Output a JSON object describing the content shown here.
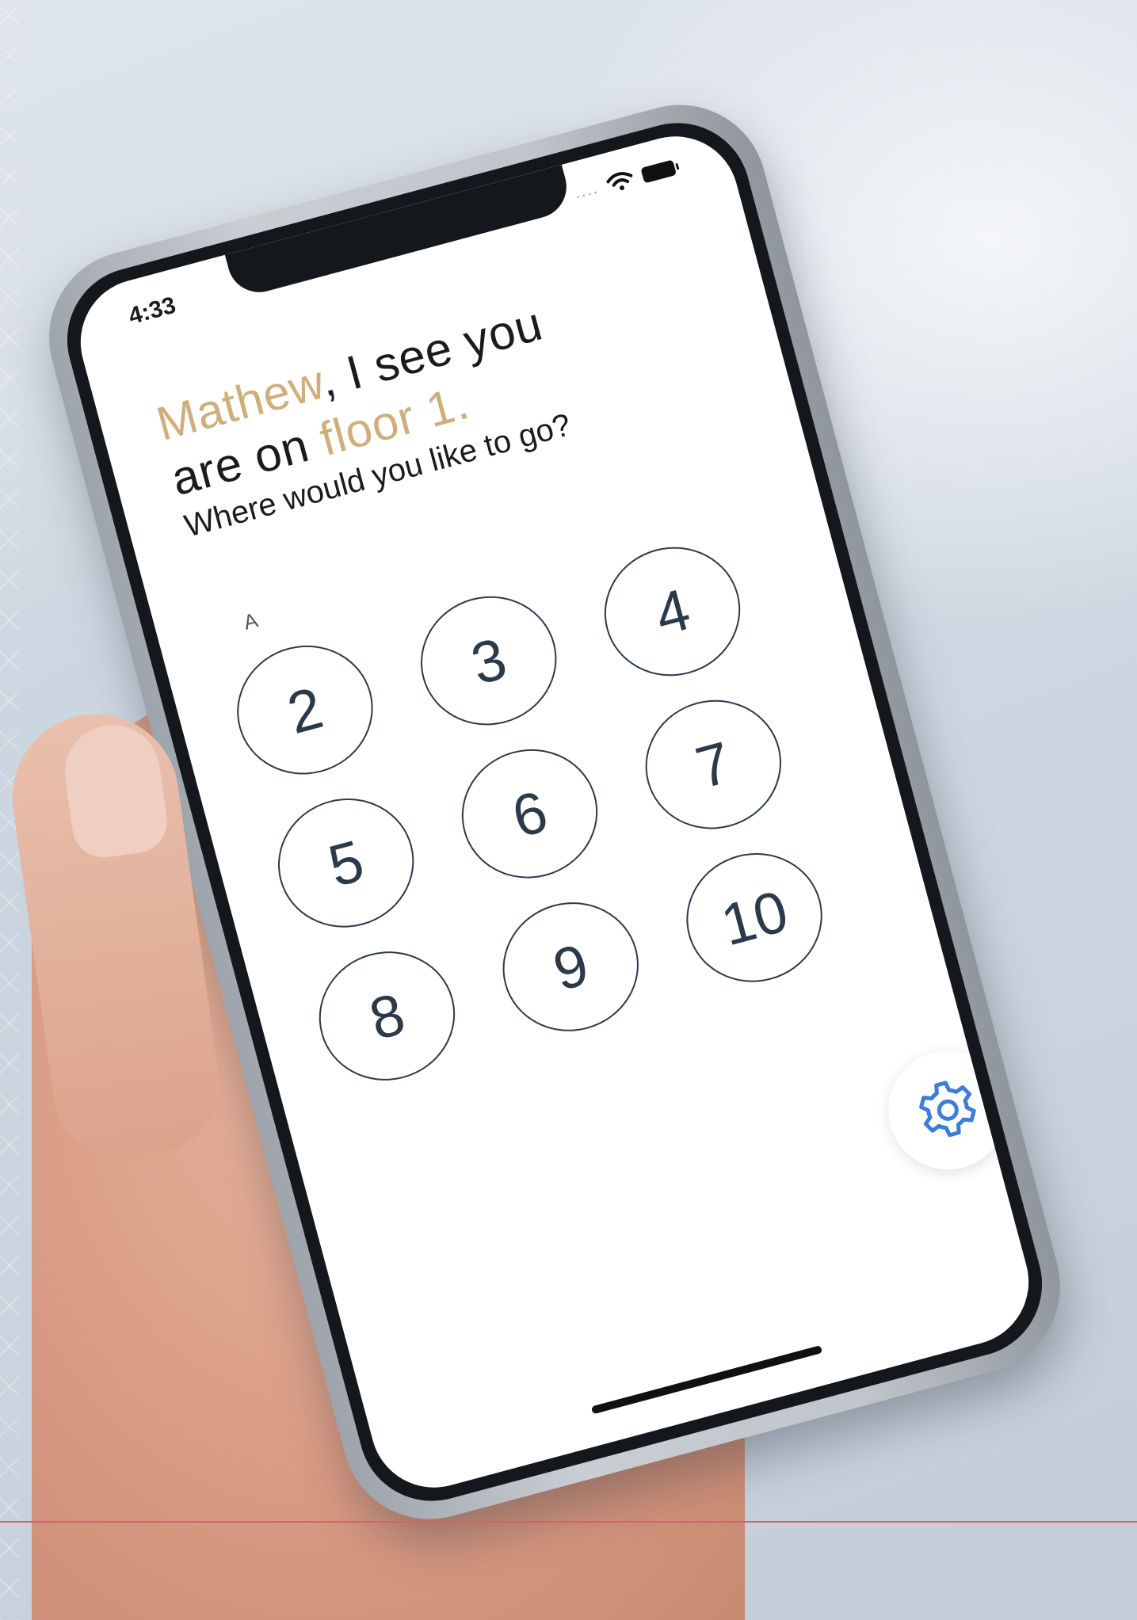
{
  "status_bar": {
    "time": "4:33",
    "signal": "....",
    "icons": [
      "wifi-icon",
      "battery-icon"
    ]
  },
  "greeting": {
    "name": "Mathew",
    "part1": ", I see you",
    "part2": "are on ",
    "floor": "floor 1.",
    "question": "Where would you like to go?"
  },
  "keypad": {
    "section_label": "A",
    "floors": [
      "2",
      "3",
      "4",
      "5",
      "6",
      "7",
      "8",
      "9",
      "10"
    ]
  },
  "settings": {
    "icon": "gear-icon"
  },
  "colors": {
    "accent_gold": "#cfae7c",
    "button_stroke": "#2b3a4a",
    "gear_blue": "#3b7dd8"
  }
}
